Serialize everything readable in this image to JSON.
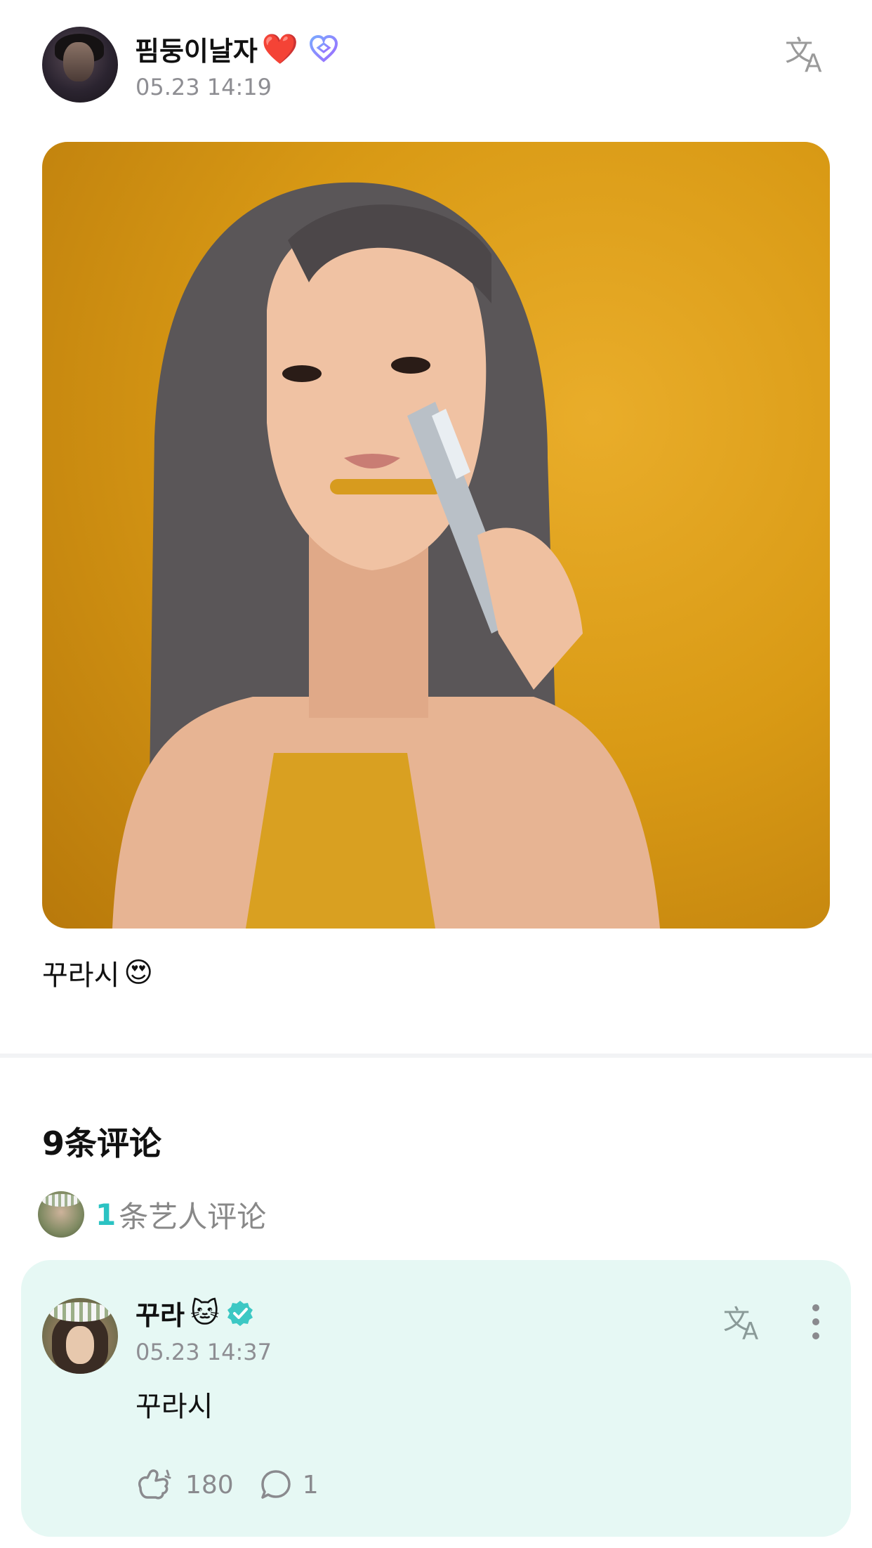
{
  "post": {
    "author": "핌둥이날자",
    "heart_emoji": "❤️",
    "timestamp": "05.23 14:19",
    "text": "꾸라시",
    "text_emoji": "😍"
  },
  "comments": {
    "title": "9条评论",
    "artist_count": "1",
    "artist_label": "条艺人评论"
  },
  "artist_comment": {
    "author": "꾸라",
    "author_emoji": "🐱",
    "timestamp": "05.23 14:37",
    "text": "꾸라시",
    "like_count": "180",
    "reply_count": "1"
  },
  "colors": {
    "accent": "#2bc3c3",
    "card_bg": "#e6f8f4",
    "muted": "#8e8e93"
  },
  "icons": [
    "translate-icon",
    "heart-badge-icon",
    "verified-icon",
    "more-icon",
    "cheer-icon",
    "reply-icon"
  ]
}
